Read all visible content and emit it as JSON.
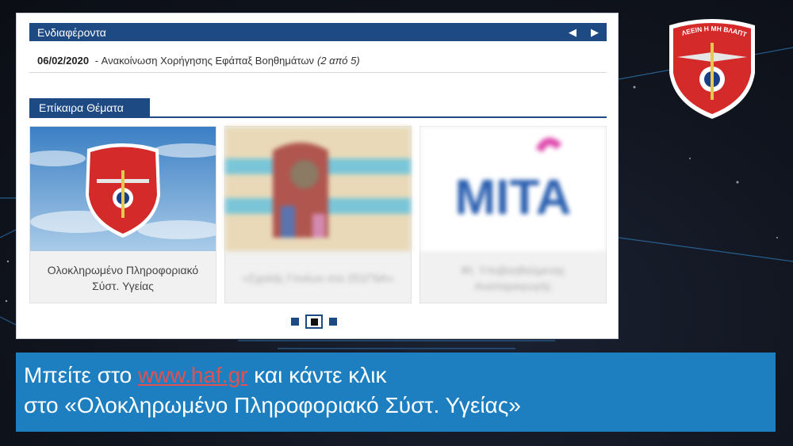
{
  "news": {
    "header": "Ενδιαφέροντα",
    "prev_arrow": "◀",
    "next_arrow": "▶",
    "item_date": "06/02/2020",
    "item_dash": " - ",
    "item_text": "Ανακοίνωση Χορήγησης Εφάπαξ Βοηθημάτων",
    "item_counter": "(2 από 5)"
  },
  "topics": {
    "tab_label": "Επίκαιρα Θέματα",
    "cards": [
      {
        "caption": "Ολοκληρωμένο Πληροφοριακό Σύστ. Υγείας"
      },
      {
        "caption": "«Σχολής Γονέων στο 251ΓΝΑ»"
      },
      {
        "caption": "ΦΙ. Υποβοηθούμενης Αναπαραγωγής"
      }
    ],
    "mita_text": "MITA"
  },
  "logo_motto": "ΩΦΕΛΕΕΙΝ Η ΜΗ ΒΛΑΠΤΕΙΝ",
  "instructions": {
    "line1_prefix": "Μπείτε στο ",
    "link": "www.haf.gr",
    "line1_suffix": " και κάντε κλικ",
    "line2": "στο «Ολοκληρωμένο Πληροφοριακό Σύστ. Υγείας»"
  },
  "colors": {
    "navy": "#1e4a84",
    "caption_bg": "#1d7fc0",
    "link": "#e05252",
    "badge_red": "#d42a2a"
  }
}
